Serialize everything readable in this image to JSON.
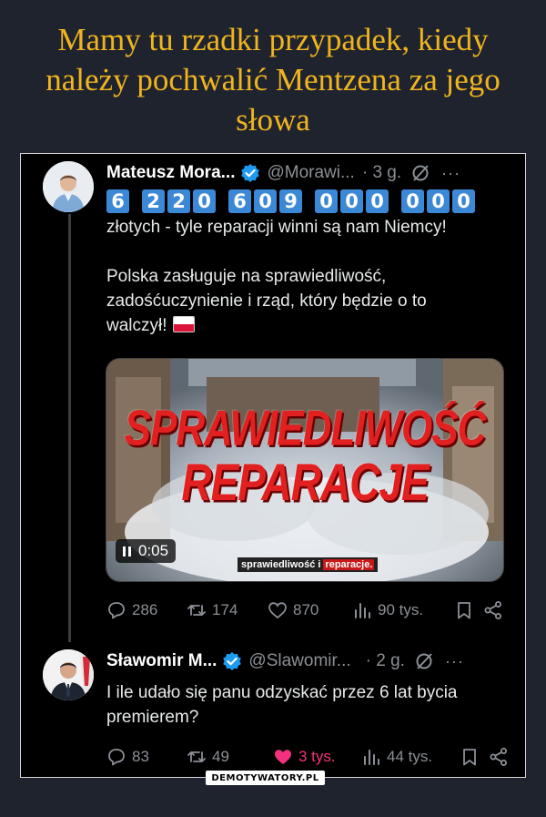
{
  "headline": {
    "line1": "Mamy tu rzadki przypadek, kiedy",
    "line2": "należy pochwalić Mentzena za jego",
    "line3": "słowa"
  },
  "tweet1": {
    "author": "Mateusz Mora...",
    "handle": "@Morawi...",
    "time": "· 3 g.",
    "more": "···",
    "digit_groups": [
      [
        "6"
      ],
      [
        "2",
        "2",
        "0"
      ],
      [
        "6",
        "0",
        "9"
      ],
      [
        "0",
        "0",
        "0"
      ],
      [
        "0",
        "0",
        "0"
      ]
    ],
    "text_line1": "złotych - tyle reparacji winni są nam Niemcy!",
    "text_line2": "Polska zasługuje na sprawiedliwość,",
    "text_line3": "zadośćuczynienie i rząd, który będzie o to",
    "text_line4": "walczył!",
    "video": {
      "title1": "SPRAWIEDLIWOŚĆ",
      "title2": "REPARACJE",
      "duration": "0:05",
      "caption_a": "sprawiedliwość i",
      "caption_b": "reparacje."
    },
    "stats": {
      "replies": "286",
      "retweets": "174",
      "likes": "870",
      "views": "90 tys."
    }
  },
  "tweet2": {
    "author": "Sławomir M...",
    "handle": "@Slawomir...",
    "time": "· 2 g.",
    "more": "···",
    "text_line1": "I ile udało się panu odzyskać przez 6 lat bycia",
    "text_line2": "premierem?",
    "stats": {
      "replies": "83",
      "retweets": "49",
      "likes": "3 tys.",
      "views": "44 tys."
    }
  },
  "watermark": "DEMOTYWATORY.PL",
  "colors": {
    "background": "#1f232e",
    "headline": "#f0b51e",
    "digit_box": "#3b88d6",
    "liked": "#f5317f",
    "muted": "#8b9096"
  }
}
